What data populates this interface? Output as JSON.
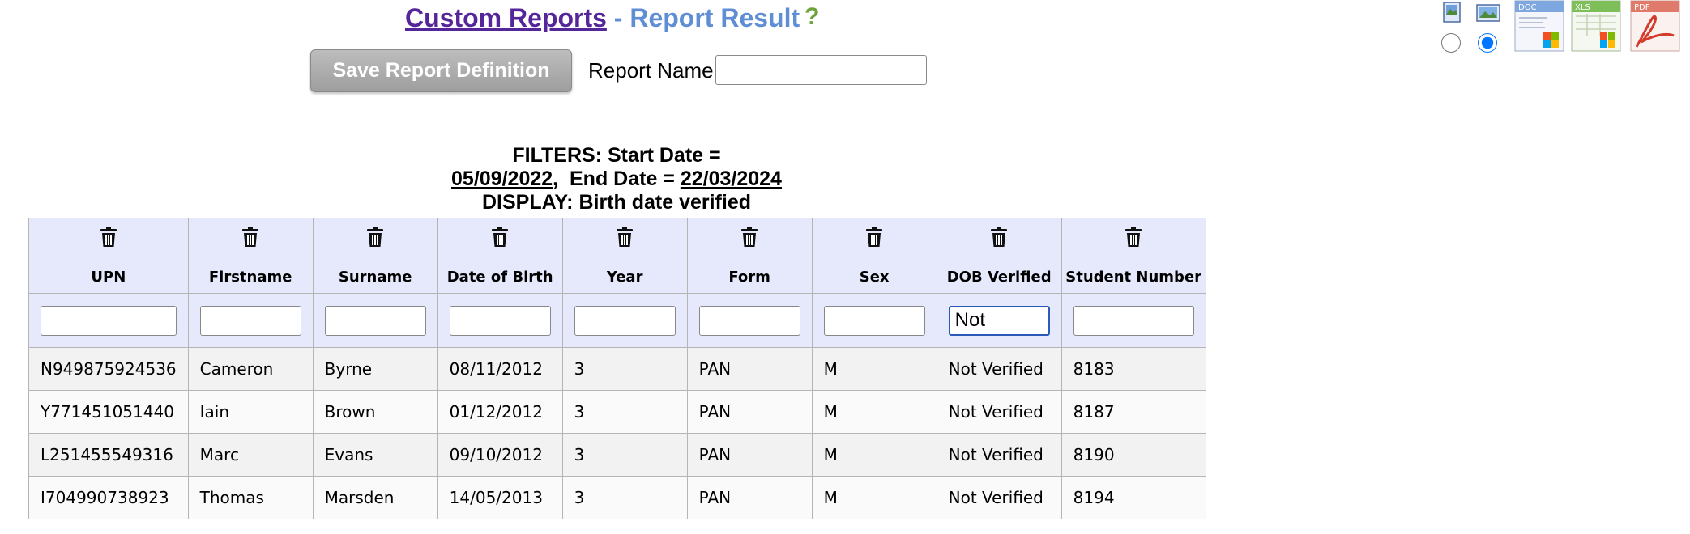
{
  "header": {
    "title_link": "Custom Reports",
    "title_separator": " - ",
    "title_sub": "Report Result",
    "help_glyph": "?"
  },
  "toolbar": {
    "save_label": "Save Report Definition",
    "report_name_label": "Report Name:",
    "report_name_value": ""
  },
  "export": {
    "orientation_selected": "landscape",
    "icons": [
      "portrait-icon",
      "landscape-icon",
      "doc-export-icon",
      "xls-export-icon",
      "pdf-export-icon"
    ],
    "doc_label": "DOC",
    "xls_label": "XLS",
    "pdf_label": "PDF"
  },
  "filters": {
    "prefix": "FILTERS: Start Date = ",
    "start_date": "05/09/2022",
    "middle": ",  End Date = ",
    "end_date": "22/03/2024",
    "display": "DISPLAY: Birth date verified"
  },
  "table": {
    "columns": [
      "UPN",
      "Firstname",
      "Surname",
      "Date of Birth",
      "Year",
      "Form",
      "Sex",
      "DOB Verified",
      "Student Number"
    ],
    "filter_values": [
      "",
      "",
      "",
      "",
      "",
      "",
      "",
      "Not",
      ""
    ],
    "rows": [
      [
        "N949875924536",
        "Cameron",
        "Byrne",
        "08/11/2012",
        "3",
        "PAN",
        "M",
        "Not Verified",
        "8183"
      ],
      [
        "Y771451051440",
        "Iain",
        "Brown",
        "01/12/2012",
        "3",
        "PAN",
        "M",
        "Not Verified",
        "8187"
      ],
      [
        "L251455549316",
        "Marc",
        "Evans",
        "09/10/2012",
        "3",
        "PAN",
        "M",
        "Not Verified",
        "8190"
      ],
      [
        "I704990738923",
        "Thomas",
        "Marsden",
        "14/05/2013",
        "3",
        "PAN",
        "M",
        "Not Verified",
        "8194"
      ]
    ]
  },
  "colors": {
    "link": "#55259a",
    "subtitle": "#5f8ed4",
    "header_bg": "#e6e9fb",
    "help": "#6ea23a"
  }
}
